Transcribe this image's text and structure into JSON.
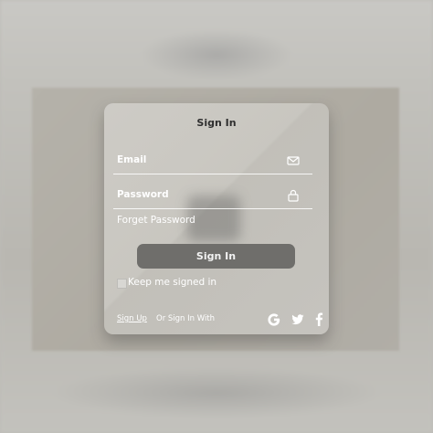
{
  "form": {
    "title": "Sign In",
    "email_label": "Email",
    "password_label": "Password",
    "forget_password": "Forget Password",
    "signin_button": "Sign In",
    "keep_signed_in": "Keep me signed in",
    "sign_up": "Sign Up",
    "or_sign_in_with": "Or Sign In With"
  },
  "icons": {
    "email": "mail-icon",
    "password": "lock-icon",
    "google": "google-icon",
    "twitter": "twitter-icon",
    "facebook": "facebook-icon"
  },
  "colors": {
    "button": "#6f6e6b",
    "text_light": "#ffffff",
    "title": "#2f2f2f"
  }
}
